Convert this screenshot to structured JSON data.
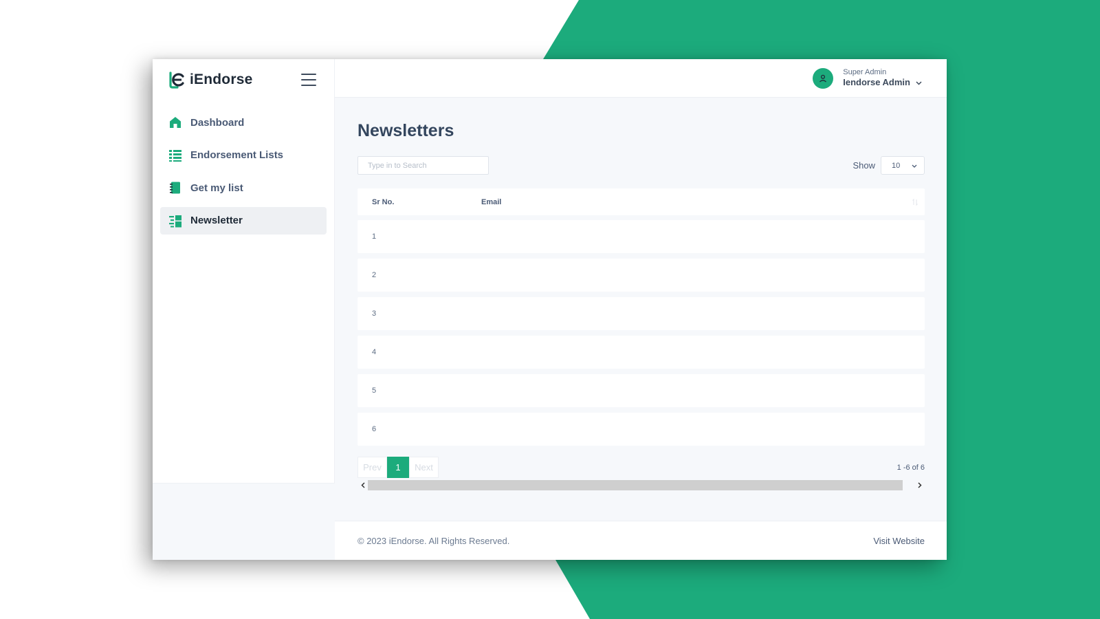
{
  "colors": {
    "accent": "#1cab7c",
    "title": "#34465e",
    "bg_content": "#f6f8fb"
  },
  "brand": {
    "name": "iEndorse",
    "logo_icon": "iendorse-logo-icon",
    "menu_icon": "hamburger-icon"
  },
  "sidebar": {
    "items": [
      {
        "label": "Dashboard",
        "icon": "home-icon",
        "active": false
      },
      {
        "label": "Endorsement Lists",
        "icon": "list-icon",
        "active": false
      },
      {
        "label": "Get my list",
        "icon": "notebook-icon",
        "active": false
      },
      {
        "label": "Newsletter",
        "icon": "newsletter-icon",
        "active": true
      }
    ]
  },
  "header": {
    "user_role": "Super Admin",
    "user_name": "Iendorse Admin",
    "avatar_icon": "user-icon"
  },
  "main": {
    "title": "Newsletters",
    "search": {
      "placeholder": "Type in to Search",
      "value": ""
    },
    "show": {
      "label": "Show",
      "value": "10"
    },
    "table": {
      "columns": [
        "Sr No.",
        "Email"
      ],
      "rows": [
        {
          "sr": "1",
          "email": ""
        },
        {
          "sr": "2",
          "email": ""
        },
        {
          "sr": "3",
          "email": ""
        },
        {
          "sr": "4",
          "email": ""
        },
        {
          "sr": "5",
          "email": ""
        },
        {
          "sr": "6",
          "email": ""
        }
      ]
    },
    "pagination": {
      "prev": "Prev",
      "page": "1",
      "next": "Next",
      "range": "1 -6 of 6"
    }
  },
  "footer": {
    "copyright": "© 2023 iEndorse. All Rights Reserved.",
    "link": "Visit Website"
  }
}
